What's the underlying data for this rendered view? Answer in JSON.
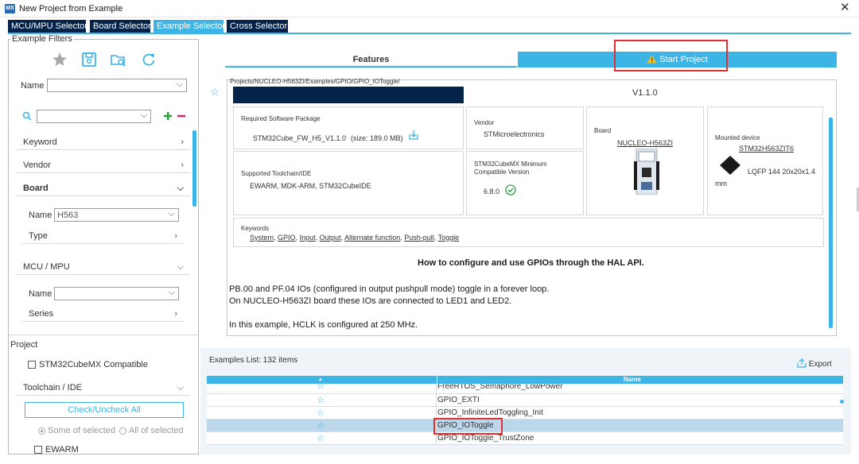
{
  "window": {
    "title": "New Project from Example",
    "app_icon": "MX",
    "close_glyph": "✕"
  },
  "tabs": [
    "MCU/MPU Selector",
    "Board Selector",
    "Example Selector",
    "Cross Selector"
  ],
  "filters": {
    "legend": "Example Filters",
    "name_label": "Name",
    "name_value": "",
    "search_value": "",
    "sections": {
      "keyword": "Keyword",
      "vendor": "Vendor",
      "board": "Board",
      "mcu": "MCU / MPU"
    },
    "board": {
      "name_label": "Name",
      "name_value": "H563",
      "type_label": "Type"
    },
    "mcu": {
      "name_label": "Name",
      "name_value": "",
      "series_label": "Series"
    },
    "project_label": "Project",
    "compatible_label": "STM32CubeMX Compatible",
    "toolchain_label": "Toolchain / IDE",
    "check_button": "Check/Uncheck All",
    "some_selected": "Some of selected",
    "all_selected": "All of selected",
    "ewarm": "EWARM"
  },
  "detail": {
    "features_tab": "Features",
    "start_project": "Start Project",
    "path": "Projects/NUCLEO-H563ZI/Examples/GPIO/GPIO_IOToggle/",
    "version": "V1.1.0",
    "required_pkg_label": "Required Software Package",
    "required_pkg_value": "STM32Cube_FW_H5_V1.1.0",
    "required_pkg_size": "(size: 189.0 MB)",
    "vendor_label": "Vendor",
    "vendor_value": "STMicroelectronics",
    "board_label": "Board",
    "board_value": "NUCLEO-H563ZI",
    "mounted_label": "Mounted device",
    "mounted_value": "STM32H563ZIT6",
    "package_value": "LQFP 144 20x20x1.4",
    "package_unit": "mm",
    "toolchain_label": "Supported Toolchain/IDE",
    "toolchain_value": "EWARM, MDK-ARM, STM32CubeIDE",
    "min_ver_label_1": "STM32CubeMX Minimum",
    "min_ver_label_2": "Compatible Version",
    "min_ver_value": "6.8.0",
    "keywords_label": "Keywords",
    "keywords": [
      "System",
      "GPIO",
      "Input",
      "Output",
      "Alternate function",
      "Push-pull",
      "Toggle"
    ],
    "heading": "How to configure and use GPIOs through the HAL API.",
    "desc_1": "PB.00 and PF.04 IOs (configured in output pushpull mode) toggle in a forever loop.",
    "desc_2": "On NUCLEO-H563ZI board these IOs are connected to LED1 and LED2.",
    "desc_3": "In this example, HCLK is configured at 250 MHz."
  },
  "examples": {
    "count_label": "Examples List: 132 items",
    "export_label": "Export",
    "col_star": "▴",
    "col_name": "Name",
    "rows": [
      {
        "name": "FreeRTOS_Semaphore_LowPower",
        "selected": false
      },
      {
        "name": "GPIO_EXTI",
        "selected": false
      },
      {
        "name": "GPIO_InfiniteLedToggling_Init",
        "selected": false
      },
      {
        "name": "GPIO_IOToggle",
        "selected": true
      },
      {
        "name": "GPIO_IOToggle_TrustZone",
        "selected": false
      }
    ]
  },
  "colors": {
    "navy": "#03234b",
    "accent": "#3cb4e6",
    "highlight": "#e03030",
    "warning": "#f5c518"
  }
}
